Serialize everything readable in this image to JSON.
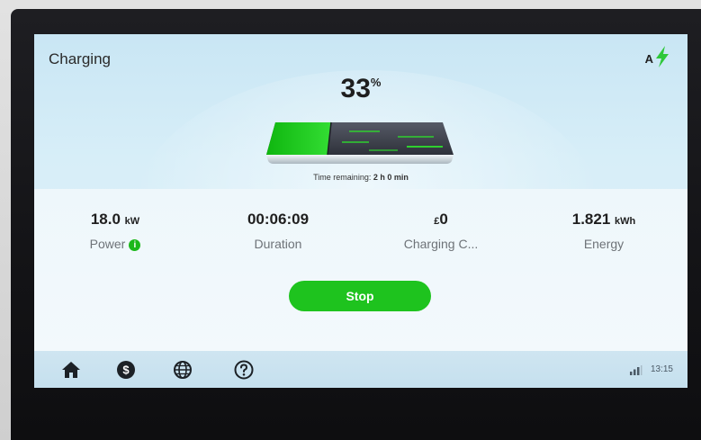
{
  "header": {
    "title": "Charging",
    "connector": "A",
    "status_icon": "lightning-bolt-icon",
    "accent_color": "#2ec83a"
  },
  "battery": {
    "percent_value": "33",
    "percent_unit": "%",
    "fill_fraction": 0.33,
    "time_remaining_label": "Time remaining:",
    "time_remaining_value": "2 h 0 min"
  },
  "stats": {
    "power": {
      "value": "18.0",
      "unit": "kW",
      "label": "Power"
    },
    "duration": {
      "value": "00:06:09",
      "label": "Duration"
    },
    "cost": {
      "currency": "£",
      "value": "0",
      "label": "Charging C..."
    },
    "energy": {
      "value": "1.821",
      "unit": "kWh",
      "label": "Energy"
    }
  },
  "actions": {
    "stop_label": "Stop",
    "stop_color": "#1ec31e"
  },
  "nav": {
    "items": [
      {
        "icon": "home-icon"
      },
      {
        "icon": "payment-icon"
      },
      {
        "icon": "globe-icon"
      },
      {
        "icon": "help-icon"
      }
    ]
  },
  "status_bar": {
    "signal_icon": "signal-icon",
    "time": "13:15"
  }
}
